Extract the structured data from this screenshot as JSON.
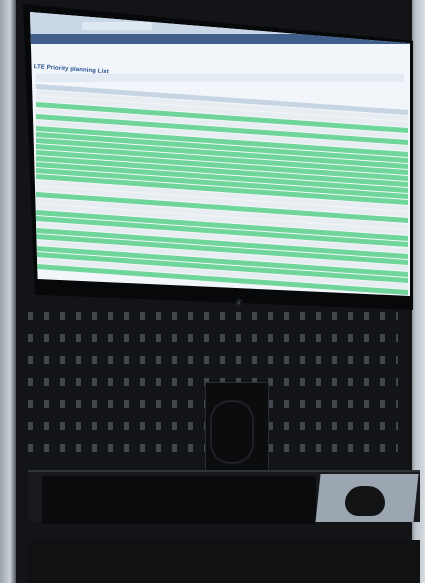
{
  "screen": {
    "title_text": "LTE Priority planning List",
    "monitor_badge": "Ⓥ"
  }
}
